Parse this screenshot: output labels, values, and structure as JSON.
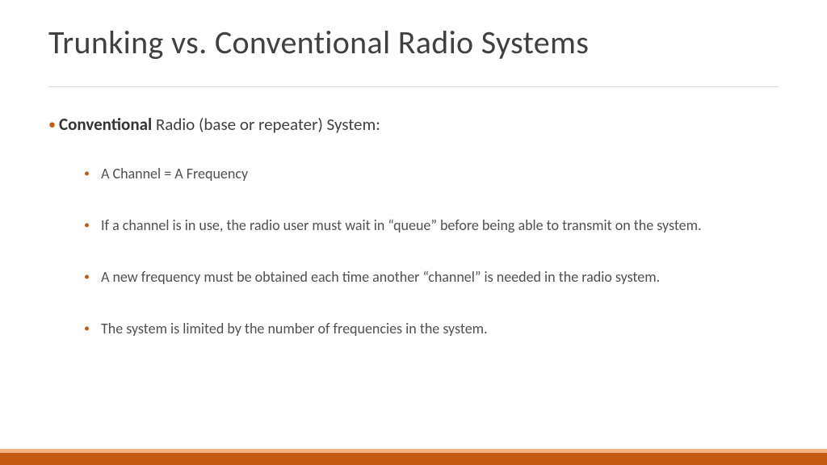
{
  "title": "Trunking vs. Conventional Radio Systems",
  "main_bullet": {
    "bold": "Conventional",
    "rest": " Radio (base or repeater) System:"
  },
  "sub_bullets": [
    "A Channel = A Frequency",
    "If a channel is in use, the radio user must wait in “queue” before being able to transmit on the system.",
    "A new frequency must be obtained each time another “channel” is needed in the radio system.",
    "The system is limited by the number of frequencies in the system."
  ]
}
